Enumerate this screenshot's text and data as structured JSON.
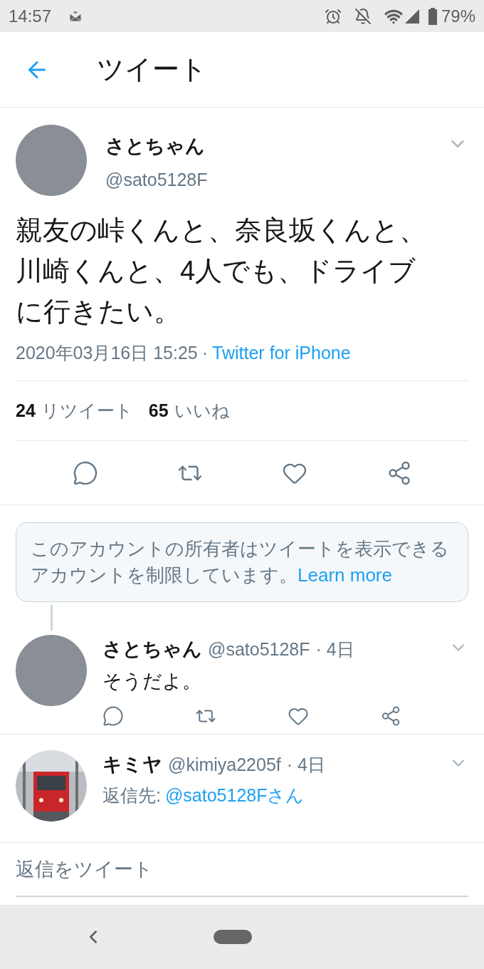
{
  "status_bar": {
    "time": "14:57",
    "battery": "79%"
  },
  "header": {
    "title": "ツイート"
  },
  "tweet": {
    "name": "さとちゃん",
    "handle": "@sato5128F",
    "text": "親友の峠くんと、奈良坂くんと、川崎くんと、4人でも、ドライブに行きたい。",
    "date": "2020年03月16日 15:25",
    "separator": "·",
    "source": "Twitter for iPhone",
    "retweets": "24",
    "retweets_label": "リツイート",
    "likes": "65",
    "likes_label": "いいね"
  },
  "notice": {
    "text": "このアカウントの所有者はツイートを表示できるアカウントを制限しています。",
    "link": "Learn more"
  },
  "replies": [
    {
      "name": "さとちゃん",
      "handle": "@sato5128F",
      "time": "· 4日",
      "text": "そうだよ。",
      "avatar": {
        "kind": "plain"
      },
      "thread_line": true
    },
    {
      "name": "キミヤ",
      "handle": "@kimiya2205f",
      "time": "· 4日",
      "reply_to_label": "返信先:",
      "reply_to": "@sato5128Fさん",
      "thread_line": false
    }
  ],
  "reply_field": {
    "placeholder": "返信をツイート"
  }
}
